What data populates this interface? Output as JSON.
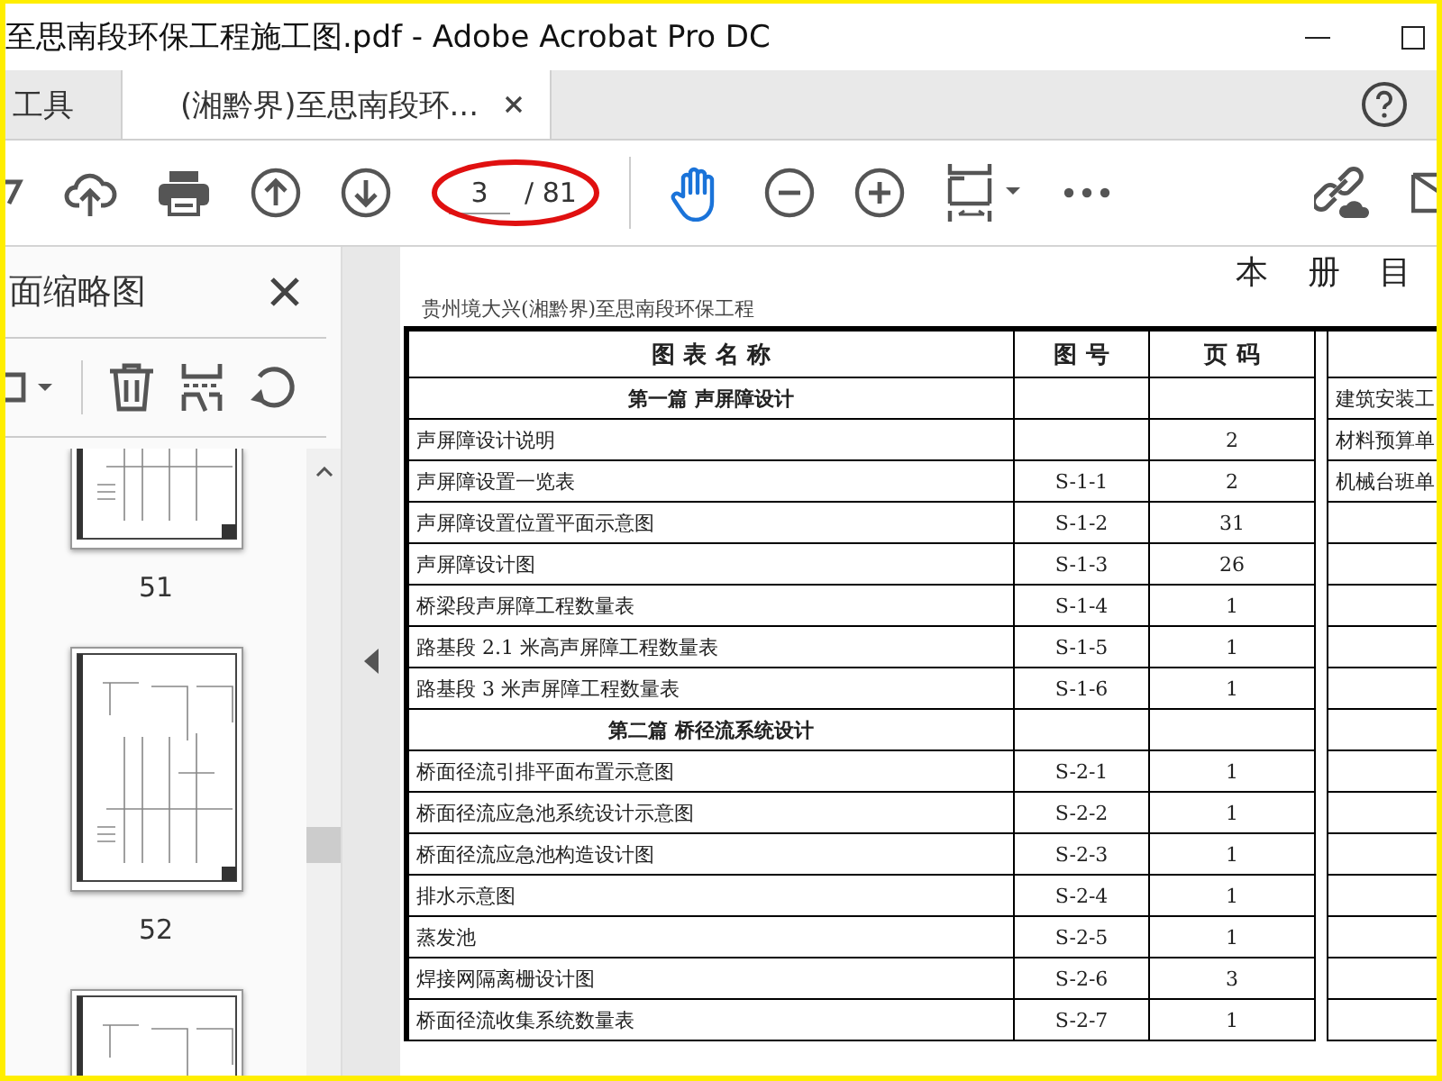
{
  "window": {
    "title": "至思南段环保工程施工图.pdf - Adobe Acrobat Pro DC"
  },
  "tabs": [
    {
      "label": "工具",
      "selected": false,
      "closable": false
    },
    {
      "label": "(湘黔界)至思南段环...",
      "selected": true,
      "closable": true
    }
  ],
  "toolbar": {
    "page_current": "3",
    "page_total": "/ 81",
    "hand_tool_on": true
  },
  "sidebar": {
    "title": "面缩略图",
    "thumbnails": [
      {
        "label": "51"
      },
      {
        "label": "52"
      }
    ],
    "partial_thumbnail_below": true
  },
  "document": {
    "header": "贵州境大兴(湘黔界)至思南段环保工程",
    "title": "本 册 目",
    "columns": [
      "图 表 名 称",
      "图 号",
      "页 码"
    ],
    "rows": [
      {
        "kind": "section",
        "name": "第一篇  声屏障设计",
        "code": "",
        "page": ""
      },
      {
        "kind": "item",
        "name": "声屏障设计说明",
        "code": "",
        "page": "2"
      },
      {
        "kind": "item",
        "name": "声屏障设置一览表",
        "code": "S-1-1",
        "page": "2"
      },
      {
        "kind": "item",
        "name": "声屏障设置位置平面示意图",
        "code": "S-1-2",
        "page": "31"
      },
      {
        "kind": "item",
        "name": "声屏障设计图",
        "code": "S-1-3",
        "page": "26"
      },
      {
        "kind": "item",
        "name": "桥梁段声屏障工程数量表",
        "code": "S-1-4",
        "page": "1"
      },
      {
        "kind": "item",
        "name": "路基段 2.1 米高声屏障工程数量表",
        "code": "S-1-5",
        "page": "1"
      },
      {
        "kind": "item",
        "name": "路基段 3 米声屏障工程数量表",
        "code": "S-1-6",
        "page": "1"
      },
      {
        "kind": "section",
        "name": "第二篇  桥径流系统设计",
        "code": "",
        "page": ""
      },
      {
        "kind": "item",
        "name": "桥面径流引排平面布置示意图",
        "code": "S-2-1",
        "page": "1"
      },
      {
        "kind": "item",
        "name": "桥面径流应急池系统设计示意图",
        "code": "S-2-2",
        "page": "1"
      },
      {
        "kind": "item",
        "name": "桥面径流应急池构造设计图",
        "code": "S-2-3",
        "page": "1"
      },
      {
        "kind": "item",
        "name": "排水示意图",
        "code": "S-2-4",
        "page": "1"
      },
      {
        "kind": "item",
        "name": "蒸发池",
        "code": "S-2-5",
        "page": "1"
      },
      {
        "kind": "item",
        "name": "焊接网隔离栅设计图",
        "code": "S-2-6",
        "page": "3"
      },
      {
        "kind": "item",
        "name": "桥面径流收集系统数量表",
        "code": "S-2-7",
        "page": "1"
      }
    ],
    "right_column": [
      "建筑安装工",
      "材料预算单",
      "机械台班单"
    ]
  }
}
